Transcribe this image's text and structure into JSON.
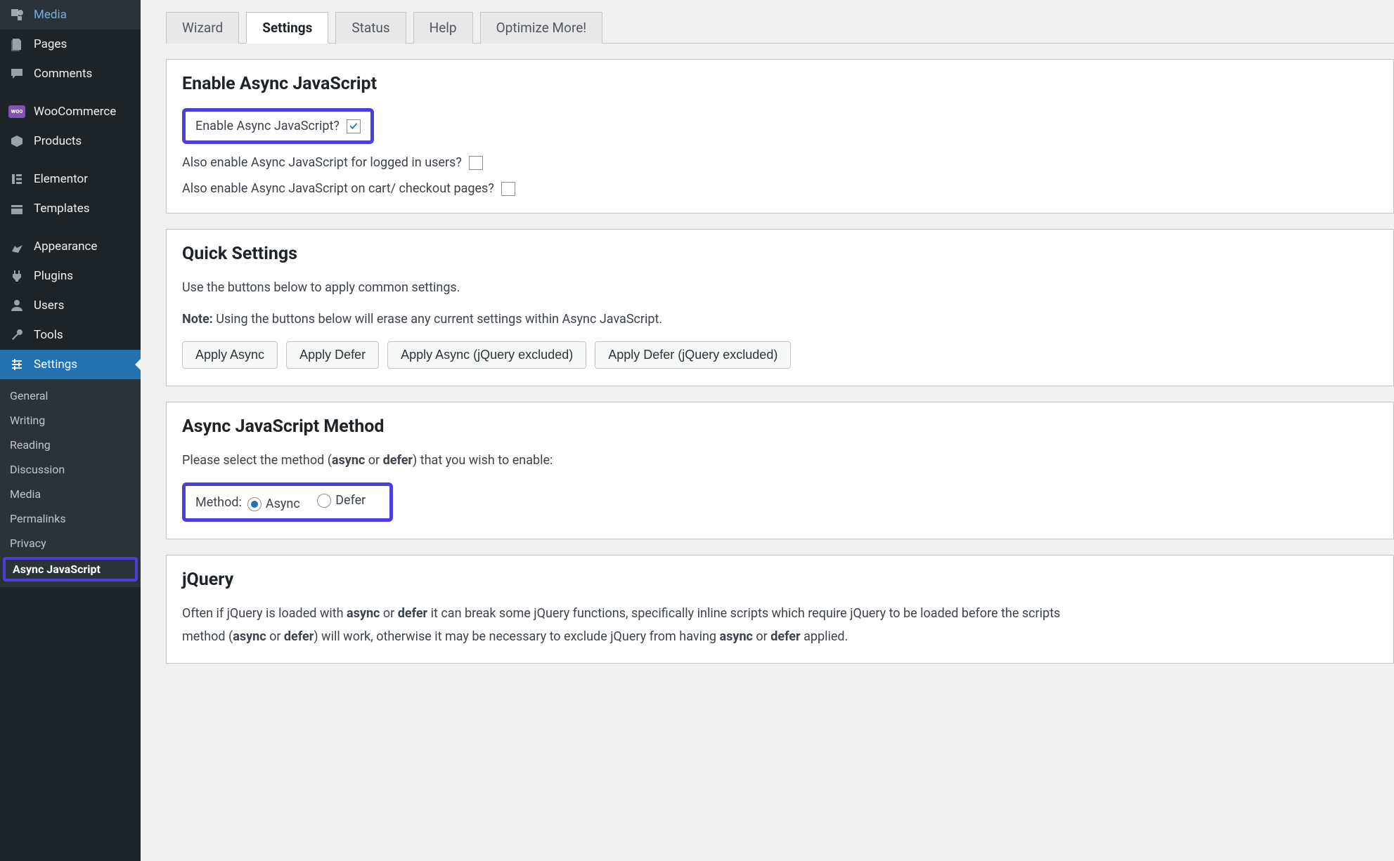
{
  "sidebar": {
    "items": [
      {
        "label": "Media"
      },
      {
        "label": "Pages"
      },
      {
        "label": "Comments"
      },
      {
        "label": "WooCommerce"
      },
      {
        "label": "Products"
      },
      {
        "label": "Elementor"
      },
      {
        "label": "Templates"
      },
      {
        "label": "Appearance"
      },
      {
        "label": "Plugins"
      },
      {
        "label": "Users"
      },
      {
        "label": "Tools"
      },
      {
        "label": "Settings"
      }
    ],
    "submenu": [
      {
        "label": "General"
      },
      {
        "label": "Writing"
      },
      {
        "label": "Reading"
      },
      {
        "label": "Discussion"
      },
      {
        "label": "Media"
      },
      {
        "label": "Permalinks"
      },
      {
        "label": "Privacy"
      },
      {
        "label": "Async JavaScript"
      }
    ]
  },
  "tabs": [
    {
      "label": "Wizard"
    },
    {
      "label": "Settings"
    },
    {
      "label": "Status"
    },
    {
      "label": "Help"
    },
    {
      "label": "Optimize More!"
    }
  ],
  "panels": {
    "enable": {
      "title": "Enable Async JavaScript",
      "opt1": "Enable Async JavaScript?",
      "opt2": "Also enable Async JavaScript for logged in users?",
      "opt3": "Also enable Async JavaScript on cart/ checkout pages?"
    },
    "quick": {
      "title": "Quick Settings",
      "desc": "Use the buttons below to apply common settings.",
      "note_label": "Note:",
      "note_text": " Using the buttons below will erase any current settings within Async JavaScript.",
      "btns": [
        "Apply Async",
        "Apply Defer",
        "Apply Async (jQuery excluded)",
        "Apply Defer (jQuery excluded)"
      ]
    },
    "method": {
      "title": "Async JavaScript Method",
      "desc_a": "Please select the method (",
      "desc_b": "async",
      "desc_c": " or ",
      "desc_d": "defer",
      "desc_e": ") that you wish to enable:",
      "label": "Method:",
      "opt_async": "Async",
      "opt_defer": "Defer"
    },
    "jquery": {
      "title": "jQuery",
      "p1a": "Often if jQuery is loaded with ",
      "p1b": "async",
      "p1c": " or ",
      "p1d": "defer",
      "p1e": " it can break some jQuery functions, specifically inline scripts which require jQuery to be loaded before the scripts",
      "p2a": "method (",
      "p2b": "async",
      "p2c": " or ",
      "p2d": "defer",
      "p2e": ") will work, otherwise it may be necessary to exclude jQuery from having ",
      "p2f": "async",
      "p2g": " or ",
      "p2h": "defer",
      "p2i": " applied."
    }
  }
}
